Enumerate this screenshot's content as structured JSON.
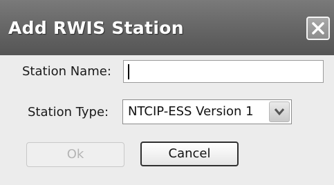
{
  "dialog": {
    "title": "Add RWIS Station",
    "close_icon": "close-x-icon"
  },
  "form": {
    "station_name_label": "Station Name:",
    "station_name_value": "",
    "station_type_label": "Station Type:",
    "station_type_selected": "NTCIP-ESS Version 1",
    "dropdown_icon": "chevron-down-icon"
  },
  "buttons": {
    "ok_label": "Ok",
    "ok_enabled": false,
    "cancel_label": "Cancel"
  }
}
